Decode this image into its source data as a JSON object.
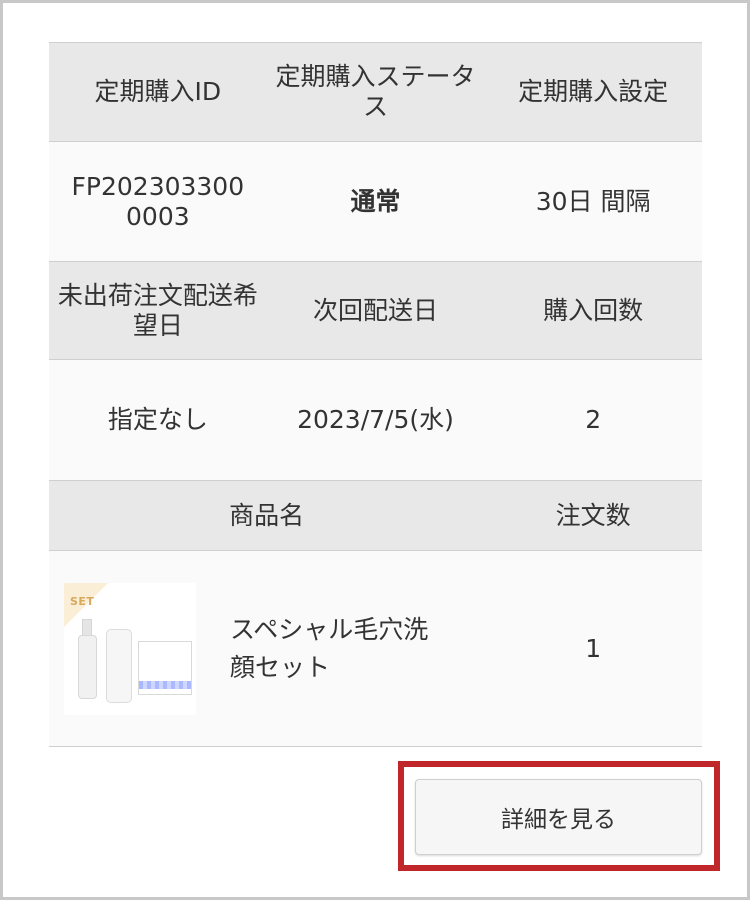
{
  "subscription": {
    "headers1": {
      "id": "定期購入ID",
      "status": "定期購入ステータス",
      "setting": "定期購入設定"
    },
    "values1": {
      "id": "FP2023033000003",
      "status": "通常",
      "interval": "30日 間隔"
    },
    "headers2": {
      "unshipped_date": "未出荷注文配送希望日",
      "next_delivery": "次回配送日",
      "purchase_count": "購入回数"
    },
    "values2": {
      "unshipped_date": "指定なし",
      "next_delivery": "2023/7/5(水)",
      "purchase_count": "2"
    },
    "product_headers": {
      "name": "商品名",
      "quantity": "注文数"
    },
    "product": {
      "badge": "SET",
      "name": "スペシャル毛穴洗顔セット",
      "quantity": "1"
    }
  },
  "actions": {
    "details_button": "詳細を見る"
  }
}
